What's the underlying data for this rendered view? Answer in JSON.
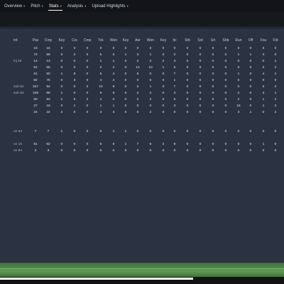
{
  "tabs": [
    {
      "label": "Overview",
      "active": false,
      "dropdown": true
    },
    {
      "label": "Pitch",
      "active": false,
      "dropdown": true
    },
    {
      "label": "Stats",
      "active": true,
      "dropdown": true
    },
    {
      "label": "Analysis",
      "active": false,
      "dropdown": true
    },
    {
      "label": "Upload Highlights",
      "active": false,
      "dropdown": true
    }
  ],
  "chevron_glyph": "▾",
  "table": {
    "columns": [
      "Inf.",
      "Pas",
      "Cmp",
      "Key",
      "Crs",
      "Cmp",
      "Tck",
      "Won",
      "Key",
      "Aer",
      "Won",
      "Key",
      "Itc",
      "Sht",
      "Sot",
      "Srt",
      "Shb",
      "Run",
      "Off",
      "Fou",
      "Fld"
    ],
    "rows": [
      {
        "inf": "",
        "values": [
          "16",
          "15",
          "0",
          "0",
          "0",
          "0",
          "0",
          "0",
          "0",
          "0",
          "0",
          "0",
          "0",
          "0",
          "0",
          "0",
          "0",
          "0",
          "0",
          "0"
        ]
      },
      {
        "inf": "",
        "values": [
          "74",
          "69",
          "0",
          "3",
          "0",
          "5",
          "5",
          "1",
          "3",
          "1",
          "0",
          "2",
          "0",
          "0",
          "0",
          "0",
          "1",
          "1",
          "4",
          "0"
        ]
      },
      {
        "inf": "inj 16",
        "values": [
          "14",
          "13",
          "0",
          "0",
          "0",
          "1",
          "1",
          "0",
          "2",
          "2",
          "2",
          "4",
          "0",
          "0",
          "0",
          "0",
          "0",
          "0",
          "0",
          "1"
        ]
      },
      {
        "inf": "",
        "values": [
          "64",
          "59",
          "0",
          "0",
          "0",
          "2",
          "2",
          "0",
          "12",
          "10",
          "1",
          "6",
          "0",
          "0",
          "0",
          "0",
          "0",
          "0",
          "2",
          "1"
        ]
      },
      {
        "inf": "",
        "values": [
          "61",
          "50",
          "1",
          "8",
          "0",
          "5",
          "4",
          "0",
          "5",
          "0",
          "0",
          "7",
          "0",
          "0",
          "0",
          "0",
          "1",
          "0",
          "4",
          "2"
        ]
      },
      {
        "inf": "",
        "values": [
          "82",
          "75",
          "0",
          "3",
          "0",
          "4",
          "4",
          "0",
          "0",
          "0",
          "0",
          "1",
          "0",
          "0",
          "0",
          "0",
          "0",
          "0",
          "0",
          "0"
        ]
      },
      {
        "inf": "sub 84",
        "values": [
          "107",
          "94",
          "0",
          "0",
          "0",
          "10",
          "8",
          "0",
          "5",
          "1",
          "0",
          "7",
          "0",
          "0",
          "0",
          "0",
          "0",
          "0",
          "0",
          "2"
        ]
      },
      {
        "inf": "sub 84",
        "values": [
          "109",
          "98",
          "1",
          "0",
          "0",
          "9",
          "8",
          "0",
          "2",
          "2",
          "0",
          "3",
          "0",
          "0",
          "0",
          "0",
          "2",
          "0",
          "4",
          "1"
        ]
      },
      {
        "inf": "",
        "values": [
          "93",
          "83",
          "1",
          "6",
          "2",
          "1",
          "0",
          "0",
          "2",
          "2",
          "0",
          "5",
          "0",
          "0",
          "0",
          "0",
          "2",
          "0",
          "1",
          "2"
        ]
      },
      {
        "inf": "",
        "values": [
          "27",
          "18",
          "0",
          "1",
          "0",
          "1",
          "1",
          "0",
          "0",
          "0",
          "0",
          "3",
          "0",
          "0",
          "0",
          "0",
          "15",
          "0",
          "1",
          "2"
        ]
      },
      {
        "inf": "",
        "values": [
          "24",
          "22",
          "2",
          "0",
          "0",
          "4",
          "3",
          "0",
          "5",
          "2",
          "0",
          "0",
          "0",
          "0",
          "0",
          "0",
          "3",
          "1",
          "0",
          "2"
        ]
      },
      {
        "inf": "on 84",
        "values": [
          "7",
          "7",
          "1",
          "0",
          "0",
          "0",
          "1",
          "1",
          "0",
          "0",
          "0",
          "0",
          "0",
          "0",
          "0",
          "0",
          "0",
          "0",
          "0",
          "0"
        ]
      },
      {
        "inf": "on 16",
        "values": [
          "61",
          "52",
          "0",
          "0",
          "0",
          "5",
          "5",
          "1",
          "7",
          "6",
          "2",
          "8",
          "0",
          "0",
          "0",
          "0",
          "0",
          "0",
          "1",
          "0"
        ]
      },
      {
        "inf": "on 84",
        "values": [
          "3",
          "3",
          "0",
          "0",
          "0",
          "0",
          "0",
          "0",
          "0",
          "0",
          "0",
          "0",
          "0",
          "0",
          "0",
          "0",
          "0",
          "0",
          "0",
          "0"
        ]
      }
    ]
  },
  "playback": {
    "progress": 0.68
  },
  "colors": {
    "tabbar": "#121417",
    "panel": "#2b3242",
    "pitch": "#4f8a47",
    "progress": "#ffffff"
  }
}
